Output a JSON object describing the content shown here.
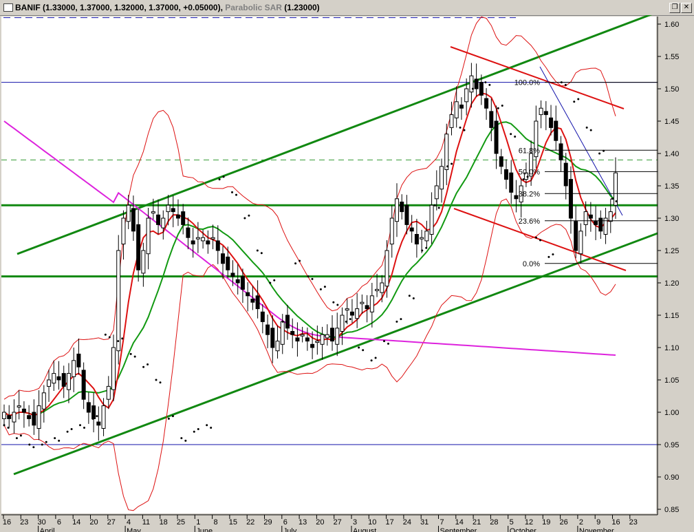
{
  "window": {
    "title_symbol": "BANIF",
    "title_values": "(1.33000, 1.37000, 1.32000, 1.37000, +0.05000)",
    "title_indicator": "Parabolic SAR",
    "title_indicator_value": "(1.23000)",
    "restore_icon": "restore-icon",
    "close_icon": "close-icon"
  },
  "chart_data": {
    "type": "candlestick",
    "y_range": [
      0.85,
      1.62
    ],
    "y_ticks": [
      "1.60",
      "1.55",
      "1.50",
      "1.45",
      "1.40",
      "1.35",
      "1.30",
      "1.25",
      "1.20",
      "1.15",
      "1.10",
      "1.05",
      "1.00",
      "0.95",
      "0.90",
      "0.85"
    ],
    "x_ticks": [
      "16",
      "23",
      "30",
      "6",
      "14",
      "20",
      "27",
      "4",
      "11",
      "18",
      "25",
      "1",
      "8",
      "15",
      "22",
      "29",
      "6",
      "13",
      "20",
      "27",
      "3",
      "10",
      "17",
      "24",
      "31",
      "7",
      "14",
      "21",
      "28",
      "5",
      "12",
      "19",
      "26",
      "2",
      "9",
      "16",
      "23"
    ],
    "months": [
      "April",
      "May",
      "June",
      "July",
      "August",
      "September",
      "October",
      "November"
    ],
    "horizontal_levels": {
      "resistance_top": 1.51,
      "support_mid_upper": 1.32,
      "support_mid_lower": 1.21,
      "support_bottom": 0.95,
      "dashed_green": 1.39,
      "dashed_blue": 1.61
    },
    "fibonacci": [
      {
        "label": "100.0%",
        "value": 1.51
      },
      {
        "label": "61.8%",
        "value": 1.405
      },
      {
        "label": "50.0%",
        "value": 1.372
      },
      {
        "label": "38.2%",
        "value": 1.338
      },
      {
        "label": "23.6%",
        "value": 1.296
      },
      {
        "label": "0.0%",
        "value": 1.23
      }
    ],
    "close": [
      1.0,
      0.99,
      1.0,
      1.01,
      1.0,
      0.99,
      0.98,
      1.01,
      1.03,
      1.05,
      1.06,
      1.05,
      1.04,
      1.06,
      1.08,
      1.07,
      1.02,
      1.0,
      0.99,
      0.98,
      1.01,
      1.04,
      1.1,
      1.25,
      1.3,
      1.32,
      1.28,
      1.22,
      1.25,
      1.3,
      1.31,
      1.29,
      1.3,
      1.32,
      1.31,
      1.3,
      1.29,
      1.27,
      1.26,
      1.27,
      1.27,
      1.26,
      1.27,
      1.25,
      1.23,
      1.22,
      1.21,
      1.2,
      1.19,
      1.18,
      1.17,
      1.16,
      1.14,
      1.12,
      1.1,
      1.11,
      1.14,
      1.13,
      1.12,
      1.11,
      1.12,
      1.11,
      1.1,
      1.11,
      1.12,
      1.12,
      1.11,
      1.13,
      1.15,
      1.16,
      1.15,
      1.16,
      1.17,
      1.16,
      1.18,
      1.19,
      1.2,
      1.25,
      1.3,
      1.33,
      1.31,
      1.29,
      1.28,
      1.26,
      1.27,
      1.28,
      1.32,
      1.35,
      1.38,
      1.43,
      1.46,
      1.48,
      1.47,
      1.5,
      1.52,
      1.5,
      1.49,
      1.47,
      1.44,
      1.4,
      1.38,
      1.36,
      1.34,
      1.33,
      1.35,
      1.37,
      1.4,
      1.45,
      1.47,
      1.46,
      1.44,
      1.42,
      1.39,
      1.35,
      1.3,
      1.25,
      1.28,
      1.31,
      1.3,
      1.29,
      1.28,
      1.3,
      1.31,
      1.37
    ],
    "series": [
      {
        "name": "",
        "color": "#dd22dd",
        "kind": "ma_long"
      },
      {
        "name": "",
        "color": "#119911",
        "kind": "ma_mid"
      },
      {
        "name": "",
        "color": "#dd1111",
        "kind": "ma_short"
      },
      {
        "name": "",
        "color": "#dd1111",
        "kind": "bollinger"
      },
      {
        "name": "Parabolic SAR",
        "color": "#000000",
        "kind": "sar"
      }
    ],
    "sar_values": [
      0.98,
      0.96,
      0.95,
      0.95,
      0.96,
      0.97,
      0.98,
      0.99,
      1.12,
      1.11,
      1.09,
      1.07,
      1.05,
      0.99,
      0.96,
      0.97,
      0.98,
      1.36,
      1.34,
      1.3,
      1.25,
      1.2,
      1.14,
      1.23,
      1.21,
      1.19,
      1.17,
      1.14,
      1.1,
      1.08,
      1.11,
      1.14,
      1.18,
      1.25,
      1.32,
      1.38,
      1.44,
      1.5,
      1.51,
      1.47,
      1.43,
      1.36,
      1.27,
      1.24,
      1.51,
      1.48,
      1.44,
      1.4,
      1.33
    ],
    "colors": {
      "up": "#ffffff",
      "down": "#000000",
      "channel": "#118811",
      "red_lines": "#dd1111",
      "fib": "#000000",
      "blue_trend": "#1111aa"
    }
  }
}
